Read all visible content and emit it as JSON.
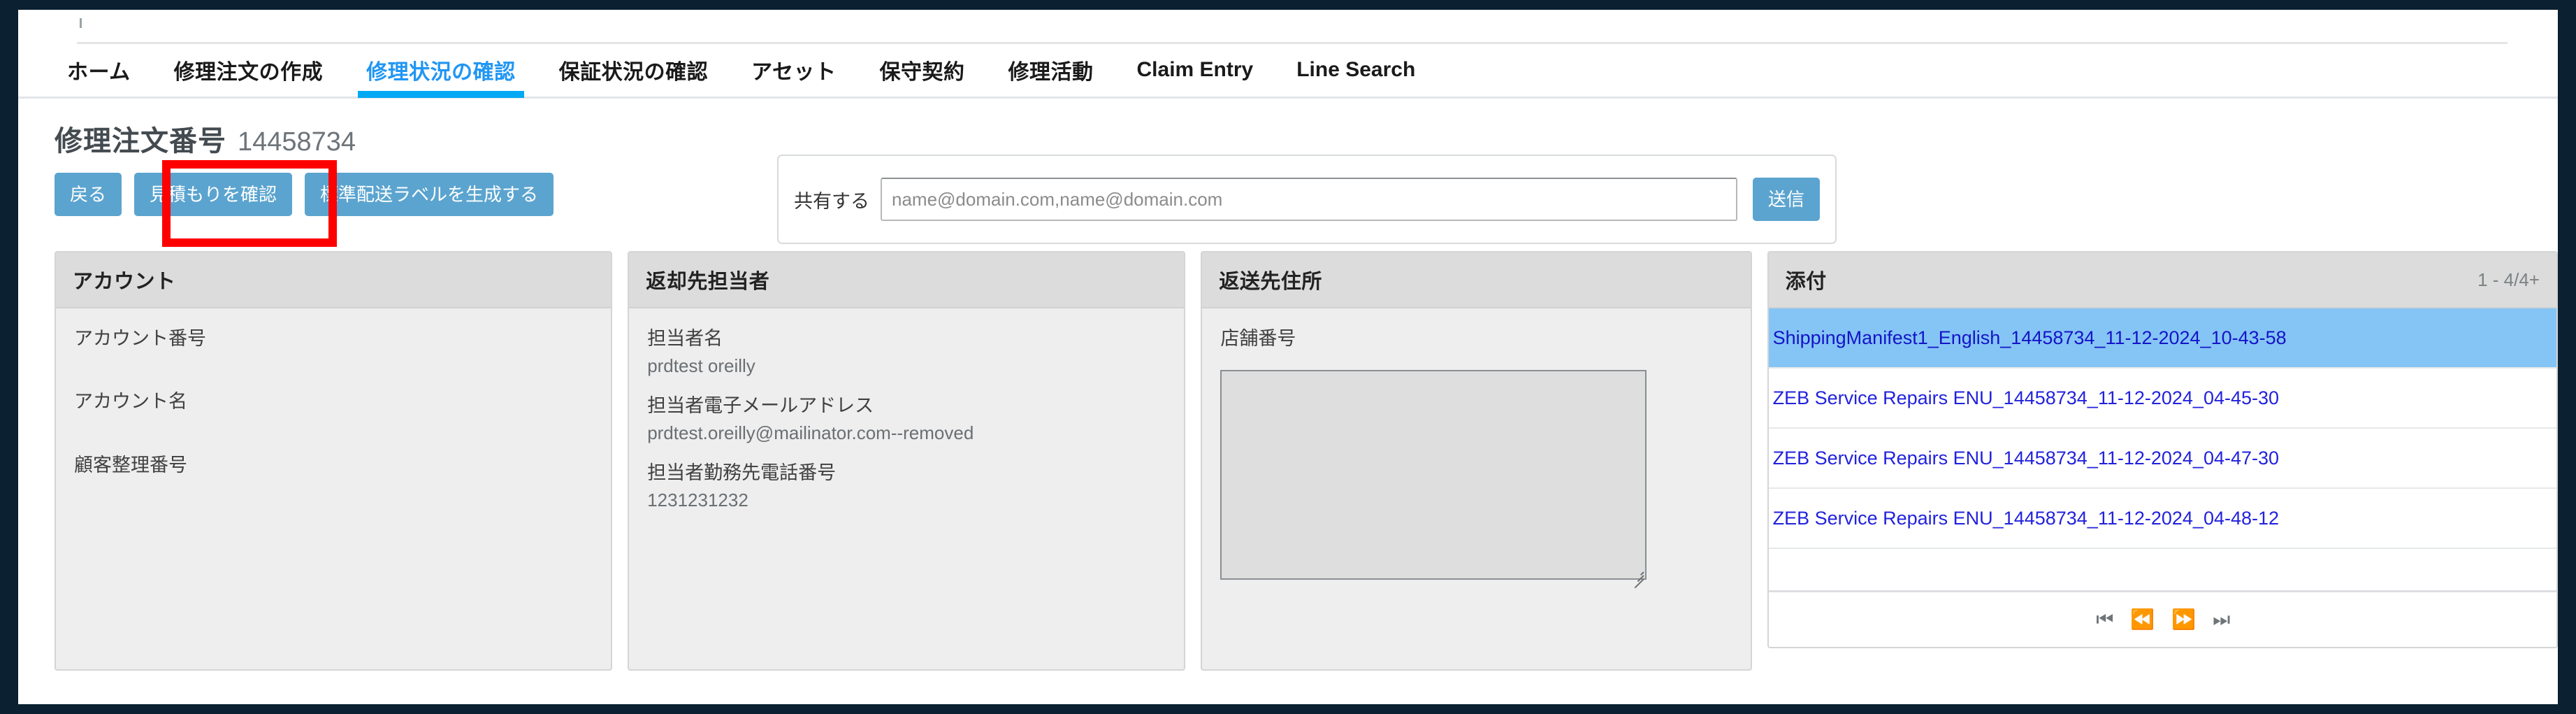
{
  "nav": {
    "items": [
      {
        "label": "ホーム",
        "active": false,
        "script": "jp"
      },
      {
        "label": "修理注文の作成",
        "active": false,
        "script": "jp"
      },
      {
        "label": "修理状況の確認",
        "active": true,
        "script": "jp"
      },
      {
        "label": "保証状況の確認",
        "active": false,
        "script": "jp"
      },
      {
        "label": "アセット",
        "active": false,
        "script": "jp"
      },
      {
        "label": "保守契約",
        "active": false,
        "script": "jp"
      },
      {
        "label": "修理活動",
        "active": false,
        "script": "jp"
      },
      {
        "label": "Claim Entry",
        "active": false,
        "script": "en"
      },
      {
        "label": "Line Search",
        "active": false,
        "script": "en"
      }
    ]
  },
  "page": {
    "title_label": "修理注文番号",
    "title_number": "14458734"
  },
  "toolbar": {
    "back_label": "戻る",
    "quote_label": "見積もりを確認",
    "label_label": "標準配送ラベルを生成する"
  },
  "share": {
    "label": "共有する",
    "placeholder": "name@domain.com,name@domain.com",
    "value": "",
    "send_label": "送信"
  },
  "cards": {
    "account": {
      "title": "アカウント",
      "fields": [
        {
          "label": "アカウント番号",
          "value": ""
        },
        {
          "label": "アカウント名",
          "value": ""
        },
        {
          "label": "顧客整理番号",
          "value": ""
        }
      ]
    },
    "contact": {
      "title": "返却先担当者",
      "fields": [
        {
          "label": "担当者名",
          "value": "prdtest oreilly"
        },
        {
          "label": "担当者電子メールアドレス",
          "value": "prdtest.oreilly@mailinator.com--removed"
        },
        {
          "label": "担当者勤務先電話番号",
          "value": "1231231232"
        }
      ]
    },
    "address": {
      "title": "返送先住所",
      "store_label": "店舗番号",
      "store_value": "",
      "textarea_value": ""
    },
    "attachments": {
      "title": "添付",
      "count": "1 - 4/4+",
      "rows": [
        {
          "name": "ShippingManifest1_English_14458734_11-12-2024_10-43-58",
          "selected": true
        },
        {
          "name": "ZEB Service Repairs ENU_14458734_11-12-2024_04-45-30",
          "selected": false
        },
        {
          "name": "ZEB Service Repairs ENU_14458734_11-12-2024_04-47-30",
          "selected": false
        },
        {
          "name": "ZEB Service Repairs ENU_14458734_11-12-2024_04-48-12",
          "selected": false
        }
      ],
      "pager": [
        {
          "icon": "first-page-icon",
          "glyph": "⏮"
        },
        {
          "icon": "previous-page-icon",
          "glyph": "⏪"
        },
        {
          "icon": "next-page-icon",
          "glyph": "⏩"
        },
        {
          "icon": "last-page-icon",
          "glyph": "⏭"
        }
      ]
    }
  },
  "annotation": {
    "highlight_color": "#ff0000",
    "highlight_target": "見積もりを確認"
  },
  "colors": {
    "accent_blue": "#03a9f4",
    "button_blue": "#5ba4cf",
    "selected_row": "#85c5f5",
    "link_blue": "#2222dd",
    "frame_navy": "#0b2030"
  }
}
